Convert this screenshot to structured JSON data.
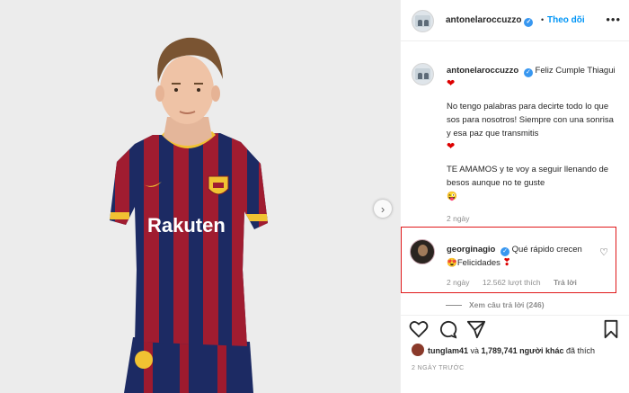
{
  "post": {
    "author": "antonelaroccuzzo",
    "dot": "•",
    "follow_label": "Theo dõi",
    "more_icon": "more-horizontal-icon",
    "next_icon": "chevron-right-icon"
  },
  "caption": {
    "username": "antonelaroccuzzo",
    "line1": "Feliz Cumple Thiagui",
    "para1": "No tengo palabras para decirte todo lo que sos para nosotros! Siempre con una sonrisa y esa paz que transmitis",
    "para2": "TE AMAMOS y te voy a seguir llenando de besos aunque no te guste",
    "heart": "❤",
    "grin": "😜",
    "time": "2 ngày"
  },
  "comment": {
    "username": "georginagio",
    "text": "Qué rápido crecen",
    "emoji_love": "😍",
    "text2": "Felicidades",
    "emoji_heart": "❣",
    "time": "2 ngày",
    "likes": "12.562 lượt thích",
    "reply": "Trả lời",
    "highlight_color": "#e0191b"
  },
  "replies": {
    "label": "Xem câu trả lời (246)"
  },
  "likes": {
    "user": "tunglam41",
    "text": " và ",
    "count": "1,789,741 người khác",
    "suffix": " đã thích"
  },
  "date": "2 NGÀY TRƯỚC",
  "jersey": {
    "sponsor": "Rakuten"
  }
}
